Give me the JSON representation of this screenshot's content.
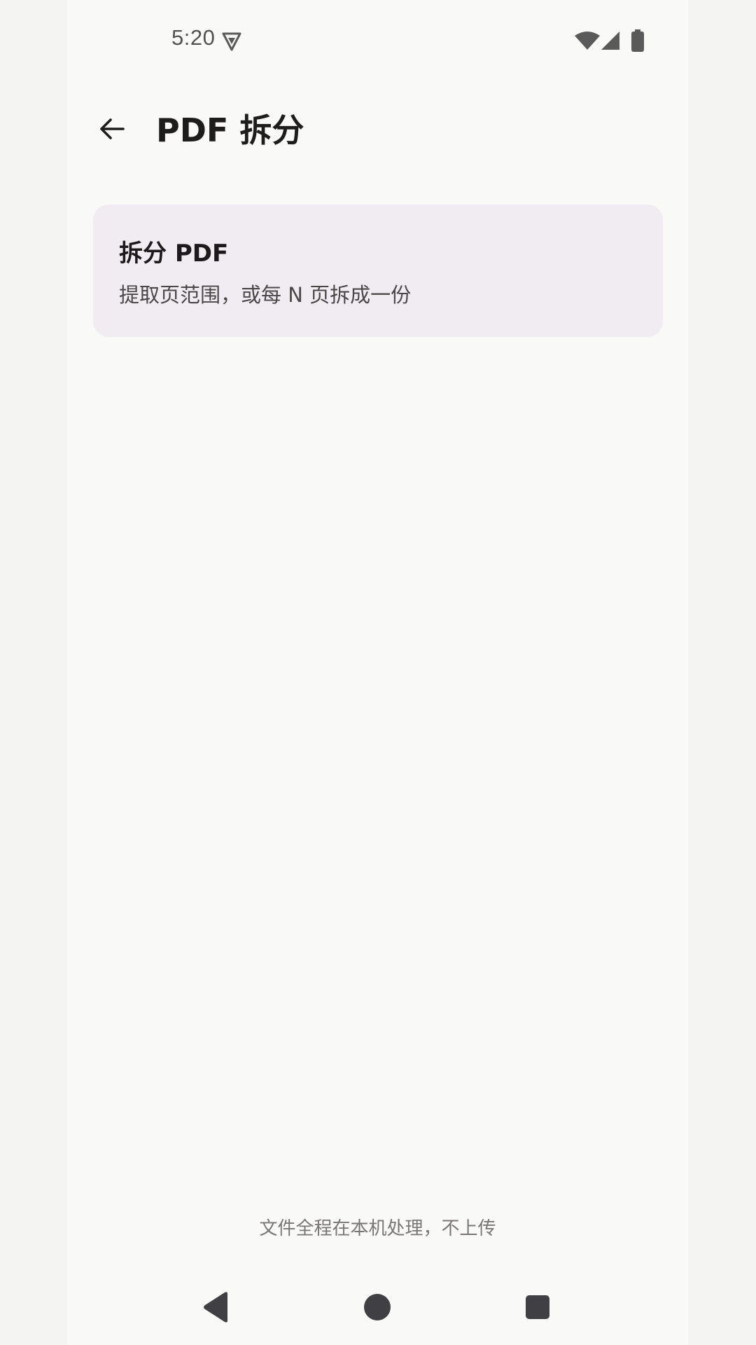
{
  "status_bar": {
    "time": "5:20",
    "icons": [
      "vpn-shield-icon",
      "wifi-icon",
      "cellular-signal-icon",
      "battery-icon"
    ]
  },
  "app_bar": {
    "back_icon": "arrow-back-icon",
    "title": "PDF 拆分"
  },
  "card": {
    "title": "拆分 PDF",
    "subtitle": "提取页范围，或每 N 页拆成一份"
  },
  "footer": {
    "note": "文件全程在本机处理，不上传"
  },
  "nav_bar": {
    "icons": [
      "nav-back-icon",
      "nav-home-icon",
      "nav-recents-icon"
    ]
  },
  "colors": {
    "background": "#f9f9f8",
    "card_background": "#f1ecf2",
    "title_text": "#1f1c1c",
    "secondary_text": "#4c4747",
    "muted_text": "#7a7676"
  }
}
